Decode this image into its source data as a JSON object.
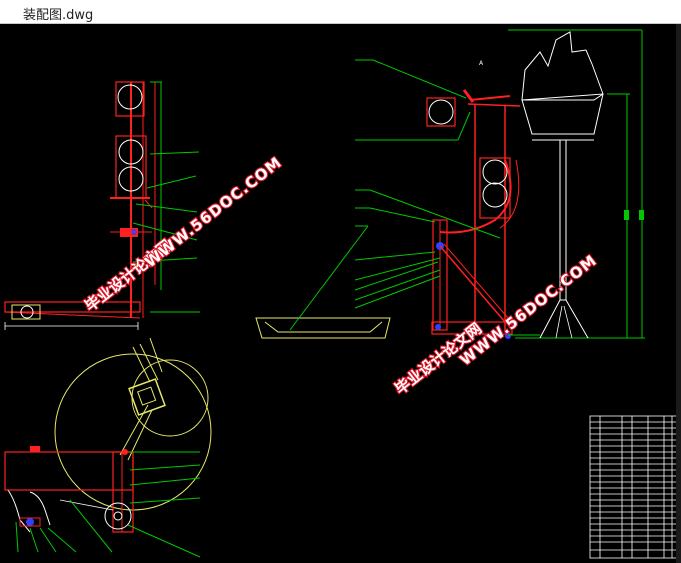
{
  "window": {
    "title": "装配图.dwg"
  },
  "watermark": {
    "site_text": "毕业设计论文网",
    "url_text": "WWW.56DOC.COM"
  },
  "drawing": {
    "note_letter": "A"
  },
  "colors": {
    "background": "#000000",
    "red": "#ff2020",
    "green": "#00c800",
    "yellow": "#e8e86a",
    "white": "#ffffff",
    "watermark_stroke": "#e0182a"
  }
}
